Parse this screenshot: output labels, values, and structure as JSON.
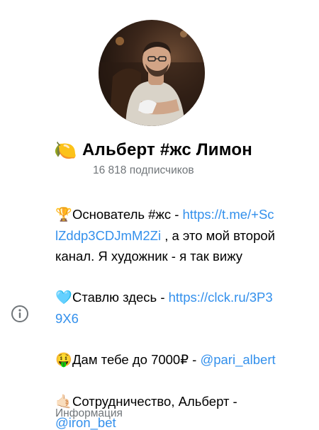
{
  "channel": {
    "title_emoji": "🍋",
    "title": "Альберт #жс Лимон",
    "subscribers": "16 818 подписчиков"
  },
  "bio": {
    "line1_emoji": "🏆",
    "line1_prefix": "Основатель #жс - ",
    "line1_link_a": "https://t.me/+Sc",
    "line1_link_b": "lZddp3CDJmM2Zi",
    "line1_suffix": " , а это мой второй",
    "line1_cont": "канал. Я художник - я так вижу",
    "line2_emoji": "🩵",
    "line2_prefix": "Ставлю здесь - ",
    "line2_link_a": "https://clck.ru/3P3",
    "line2_link_b": "9X6",
    "line3_emoji": "🤑",
    "line3_prefix": "Дам тебе до 7000₽ - ",
    "line3_link": "@pari_albert",
    "line4_emoji": "🤙🏻",
    "line4_prefix": "Сотрудничество, Альберт -",
    "line4_link": "@iron_bet"
  },
  "info_label": "Информация",
  "icons": {
    "info": "info-circle-icon",
    "avatar": "channel-avatar"
  },
  "colors": {
    "link": "#3390ec",
    "secondary_text": "#707579"
  }
}
